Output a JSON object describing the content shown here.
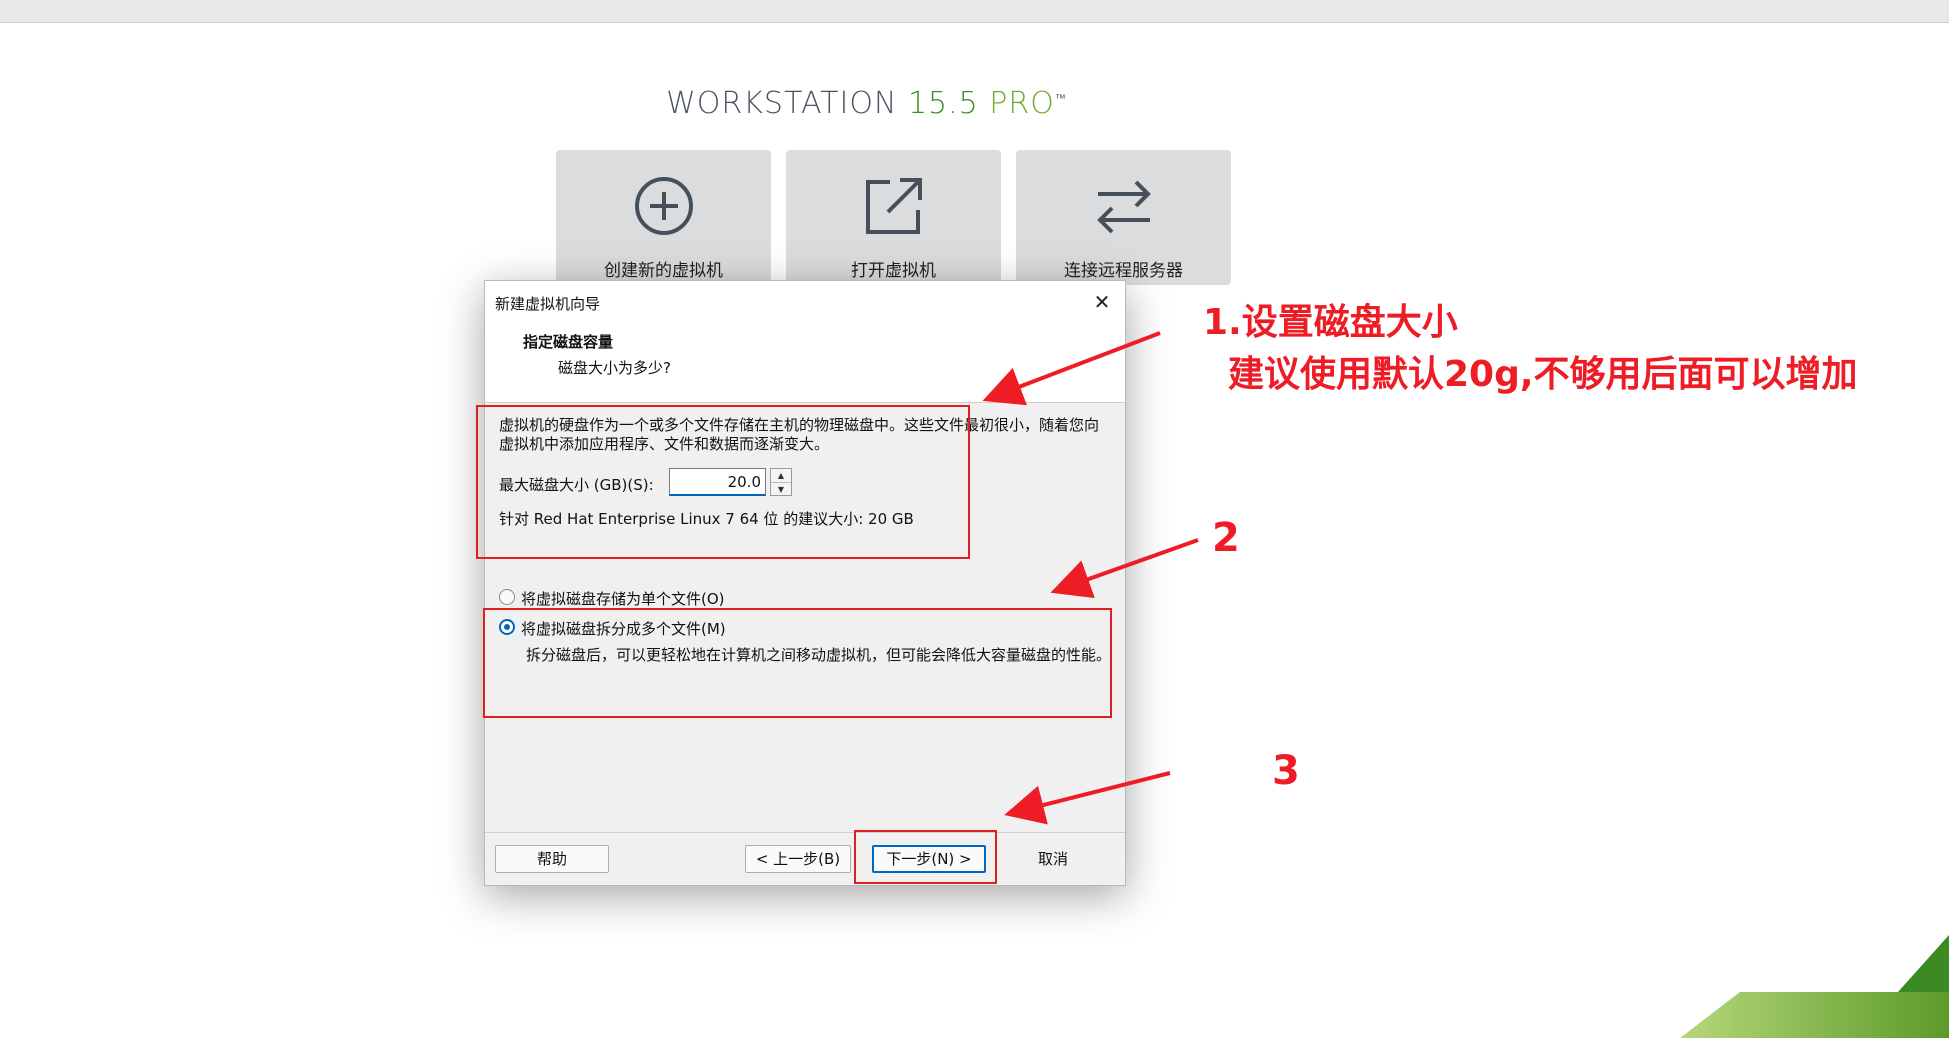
{
  "brand": {
    "word": "WORKSTATION",
    "version": "15.5",
    "edition": "PRO",
    "tm": "™"
  },
  "tiles": [
    {
      "label": "创建新的虚拟机",
      "icon": "plus-circle-icon"
    },
    {
      "label": "打开虚拟机",
      "icon": "open-external-icon"
    },
    {
      "label": "连接远程服务器",
      "icon": "swap-arrows-icon"
    }
  ],
  "dialog": {
    "title": "新建虚拟机向导",
    "step_title": "指定磁盘容量",
    "step_subtitle": "磁盘大小为多少?",
    "description": "虚拟机的硬盘作为一个或多个文件存储在主机的物理磁盘中。这些文件最初很小，随着您向虚拟机中添加应用程序、文件和数据而逐渐变大。",
    "max_size_label": "最大磁盘大小 (GB)(S):",
    "max_size_value": "20.0",
    "recommendation": "针对 Red Hat Enterprise Linux 7 64 位 的建议大小: 20 GB",
    "option_single": "将虚拟磁盘存储为单个文件(O)",
    "option_multi": "将虚拟磁盘拆分成多个文件(M)",
    "option_multi_desc": "拆分磁盘后，可以更轻松地在计算机之间移动虚拟机，但可能会降低大容量磁盘的性能。",
    "selected_option": "multi",
    "buttons": {
      "help": "帮助",
      "back": "< 上一步(B)",
      "next": "下一步(N) >",
      "cancel": "取消"
    }
  },
  "annotations": {
    "step1_line1": "1.设置磁盘大小",
    "step1_line2": "建议使用默认20g,不够用后面可以增加",
    "step2": "2",
    "step3": "3",
    "color": "#ee1c25"
  },
  "colors": {
    "accent": "#0067c0",
    "brand_green": "#6eaa2f",
    "annotation_red": "#ee1c25"
  }
}
